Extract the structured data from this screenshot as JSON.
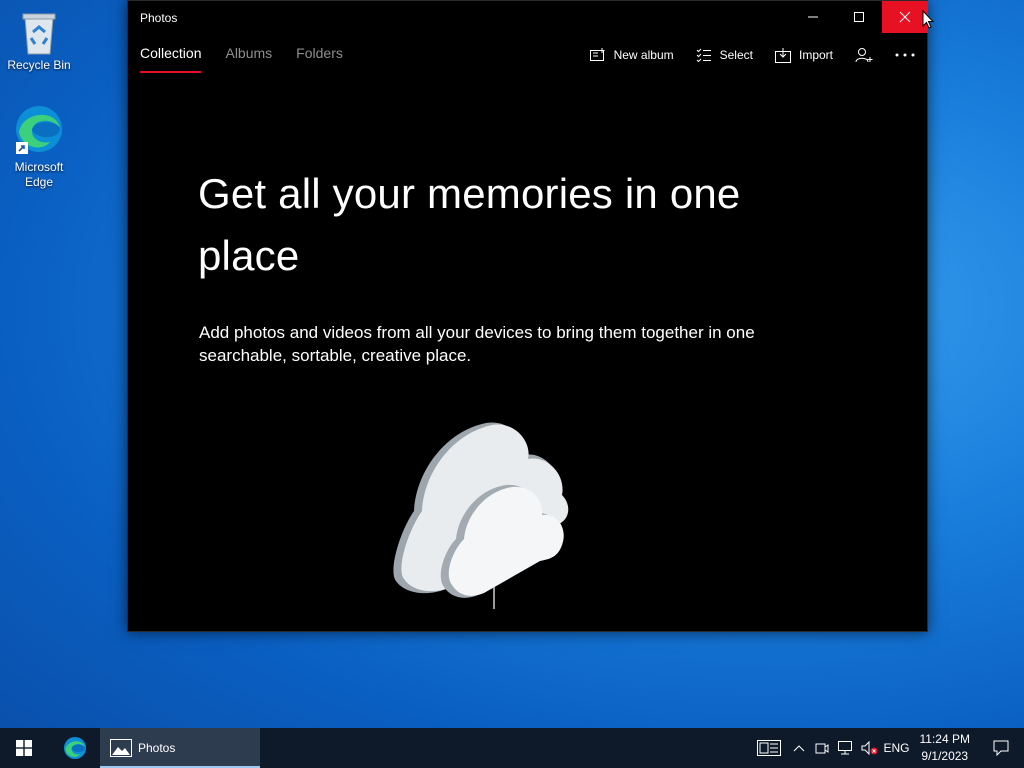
{
  "desktop": {
    "icons": [
      {
        "label": "Recycle Bin",
        "icon": "recycle-bin-icon"
      },
      {
        "label": "Microsoft Edge",
        "icon": "edge-icon"
      }
    ]
  },
  "window": {
    "title": "Photos",
    "controls": [
      "minimize-icon",
      "maximize-icon",
      "close-icon"
    ],
    "close_color": "#e81123"
  },
  "tabs": [
    {
      "label": "Collection",
      "active": true
    },
    {
      "label": "Albums",
      "active": false
    },
    {
      "label": "Folders",
      "active": false
    }
  ],
  "actions": {
    "new_album": "New album",
    "select": "Select",
    "import": "Import",
    "account_icon": "person-add-icon",
    "more_icon": "more-options-icon"
  },
  "content": {
    "headline": "Get all your memories in one place",
    "subtext": "Add photos and videos from all your devices to bring them together in one searchable, sortable, creative place.",
    "illustration": "cloud-illustration"
  },
  "taskbar": {
    "app_label": "Photos",
    "language": "ENG",
    "time": "11:24 PM",
    "date": "9/1/2023"
  },
  "colors": {
    "accent": "#e81123",
    "window_bg": "#000000",
    "taskbar_bg": "#0e1a2a"
  }
}
